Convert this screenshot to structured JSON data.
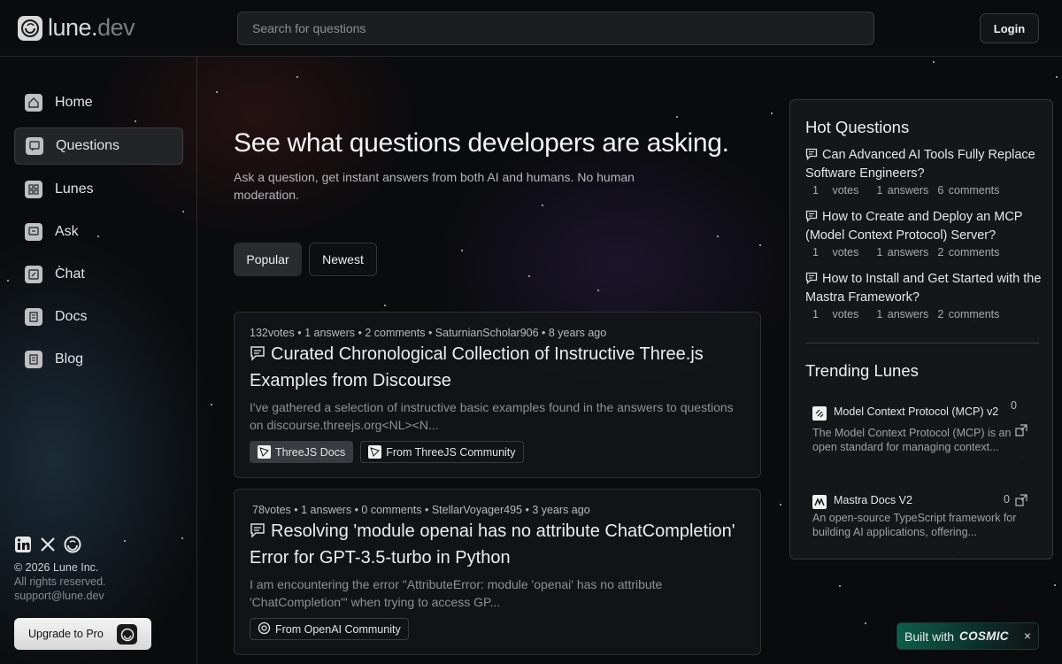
{
  "header": {
    "logo_main": "lune.",
    "logo_suffix": "dev",
    "search_placeholder": "Search for questions",
    "login_label": "Login"
  },
  "sidebar": {
    "items": [
      {
        "label": "Home",
        "icon": "home-icon"
      },
      {
        "label": "Questions",
        "icon": "questions-icon",
        "active": true
      },
      {
        "label": "Lunes",
        "icon": "grid-icon"
      },
      {
        "label": "Ask",
        "icon": "ask-icon"
      },
      {
        "label": "Chat",
        "icon": "chat-icon"
      },
      {
        "label": "Docs",
        "icon": "docs-icon"
      },
      {
        "label": "Blog",
        "icon": "blog-icon"
      }
    ],
    "copyright": "© 2026 Lune Inc.",
    "rights": "All rights reserved.",
    "email": "support@lune.dev",
    "upgrade_label": "Upgrade to Pro"
  },
  "main": {
    "title": "See what questions developers are asking.",
    "subtitle": "Ask a question, get instant answers from both AI and humans. No human moderation.",
    "tabs": [
      "Popular",
      "Newest"
    ],
    "cards": [
      {
        "votes": "132votes",
        "answers": "1 answers",
        "comments": "2 comments",
        "author": "SaturnianScholar906",
        "time": "8 years ago",
        "title": "Curated Chronological Collection of Instructive Three.js Examples from Discourse",
        "desc": "I've gathered a selection of instructive basic examples found in the answers to questions on discourse.threejs.org<NL><N...",
        "tags": [
          "ThreeJS Docs",
          "From ThreeJS Community"
        ]
      },
      {
        "votes": "78votes",
        "answers": "1 answers",
        "comments": "0 comments",
        "author": "StellarVoyager495",
        "time": "3 years ago",
        "title": "Resolving 'module openai has no attribute ChatCompletion' Error for GPT-3.5-turbo in Python",
        "desc": "I am encountering the error \"AttributeError: module 'openai' has no attribute 'ChatCompletion'\" when trying to access GP...",
        "tags": [
          "From OpenAI Community"
        ]
      }
    ]
  },
  "panel": {
    "hot_title": "Hot Questions",
    "hot": [
      {
        "title": "Can Advanced AI Tools Fully Replace Software Engineers?",
        "votes": "1",
        "votes_label": "votes",
        "answers": "1 answers",
        "comments": "6 comments"
      },
      {
        "title": "How to Create and Deploy an MCP (Model Context Protocol) Server?",
        "votes": "1",
        "votes_label": "votes",
        "answers": "1 answers",
        "comments": "2 comments"
      },
      {
        "title": "How to Install and Get Started with the Mastra Framework?",
        "votes": "1",
        "votes_label": "votes",
        "answers": "1 answers",
        "comments": "2 comments"
      }
    ],
    "trending_title": "Trending Lunes",
    "lunes": [
      {
        "title": "Model Context Protocol (MCP) v2",
        "count": "0",
        "desc": "The Model Context Protocol (MCP) is an open standard for managing context..."
      },
      {
        "title": "Mastra Docs V2",
        "count": "0",
        "desc": "An open-source TypeScript framework for building AI applications, offering..."
      }
    ]
  },
  "cosmic": {
    "built_with": "Built with",
    "brand": "COSMIC",
    "close": "×"
  }
}
